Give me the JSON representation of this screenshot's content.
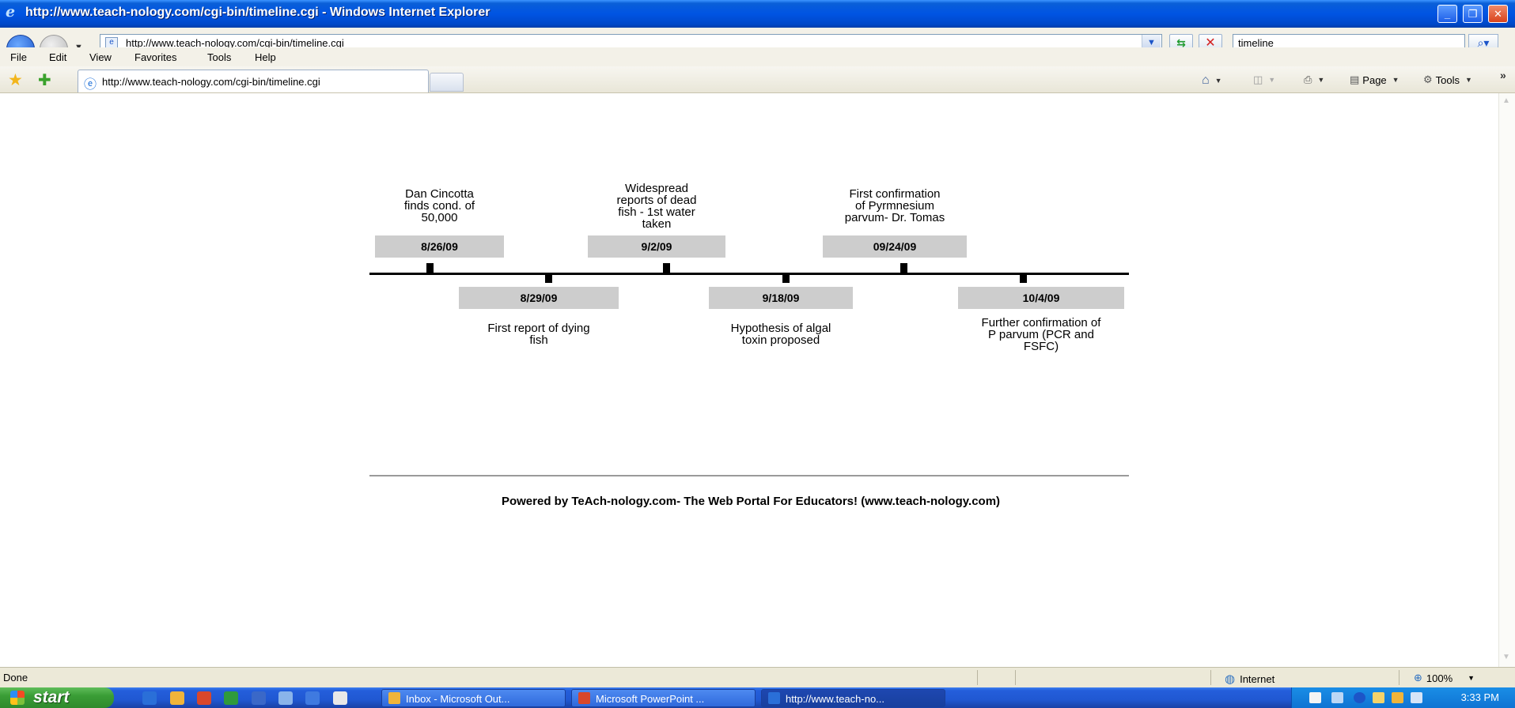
{
  "window": {
    "title": "http://www.teach-nology.com/cgi-bin/timeline.cgi - Windows Internet Explorer",
    "address": "http://www.teach-nology.com/cgi-bin/timeline.cgi",
    "search_value": "timeline"
  },
  "menu": [
    "File",
    "Edit",
    "View",
    "Favorites",
    "Tools",
    "Help"
  ],
  "tab": {
    "active_title": "http://www.teach-nology.com/cgi-bin/timeline.cgi"
  },
  "command_bar": {
    "page_label": "Page",
    "tools_label": "Tools"
  },
  "timeline": {
    "events": [
      {
        "date": "8/26/09",
        "label": "Dan Cincotta\nfinds cond. of\n50,000",
        "position": "above"
      },
      {
        "date": "8/29/09",
        "label": "First report of dying\nfish",
        "position": "below"
      },
      {
        "date": "9/2/09",
        "label": "Widespread\nreports of dead\nfish - 1st water\ntaken",
        "position": "above"
      },
      {
        "date": "9/18/09",
        "label": "Hypothesis of algal\ntoxin proposed",
        "position": "below"
      },
      {
        "date": "09/24/09",
        "label": "First confirmation\nof Pyrmnesium\nparvum- Dr. Tomas",
        "position": "above"
      },
      {
        "date": "10/4/09",
        "label": "Further confirmation of\nP parvum (PCR and\nFSFC)",
        "position": "below"
      }
    ]
  },
  "footer": {
    "text": "Powered by TeAch-nology.com- The Web Portal For Educators! (www.teach-nology.com)"
  },
  "status": {
    "left": "Done",
    "zone": "Internet",
    "zoom": "100%"
  },
  "taskbar": {
    "start_label": "start",
    "tasks": [
      {
        "label": "Inbox - Microsoft Out...",
        "icon": "outlook-icon",
        "active": false
      },
      {
        "label": "Microsoft PowerPoint ...",
        "icon": "powerpoint-icon",
        "active": false
      },
      {
        "label": "http://www.teach-no...",
        "icon": "ie-icon",
        "active": true
      }
    ],
    "clock": "3:33 PM"
  },
  "colors": {
    "titlebar": "#0054e3",
    "date_box": "#cdcdcd",
    "taskbar": "#245edb",
    "start_button": "#3a9d36"
  }
}
